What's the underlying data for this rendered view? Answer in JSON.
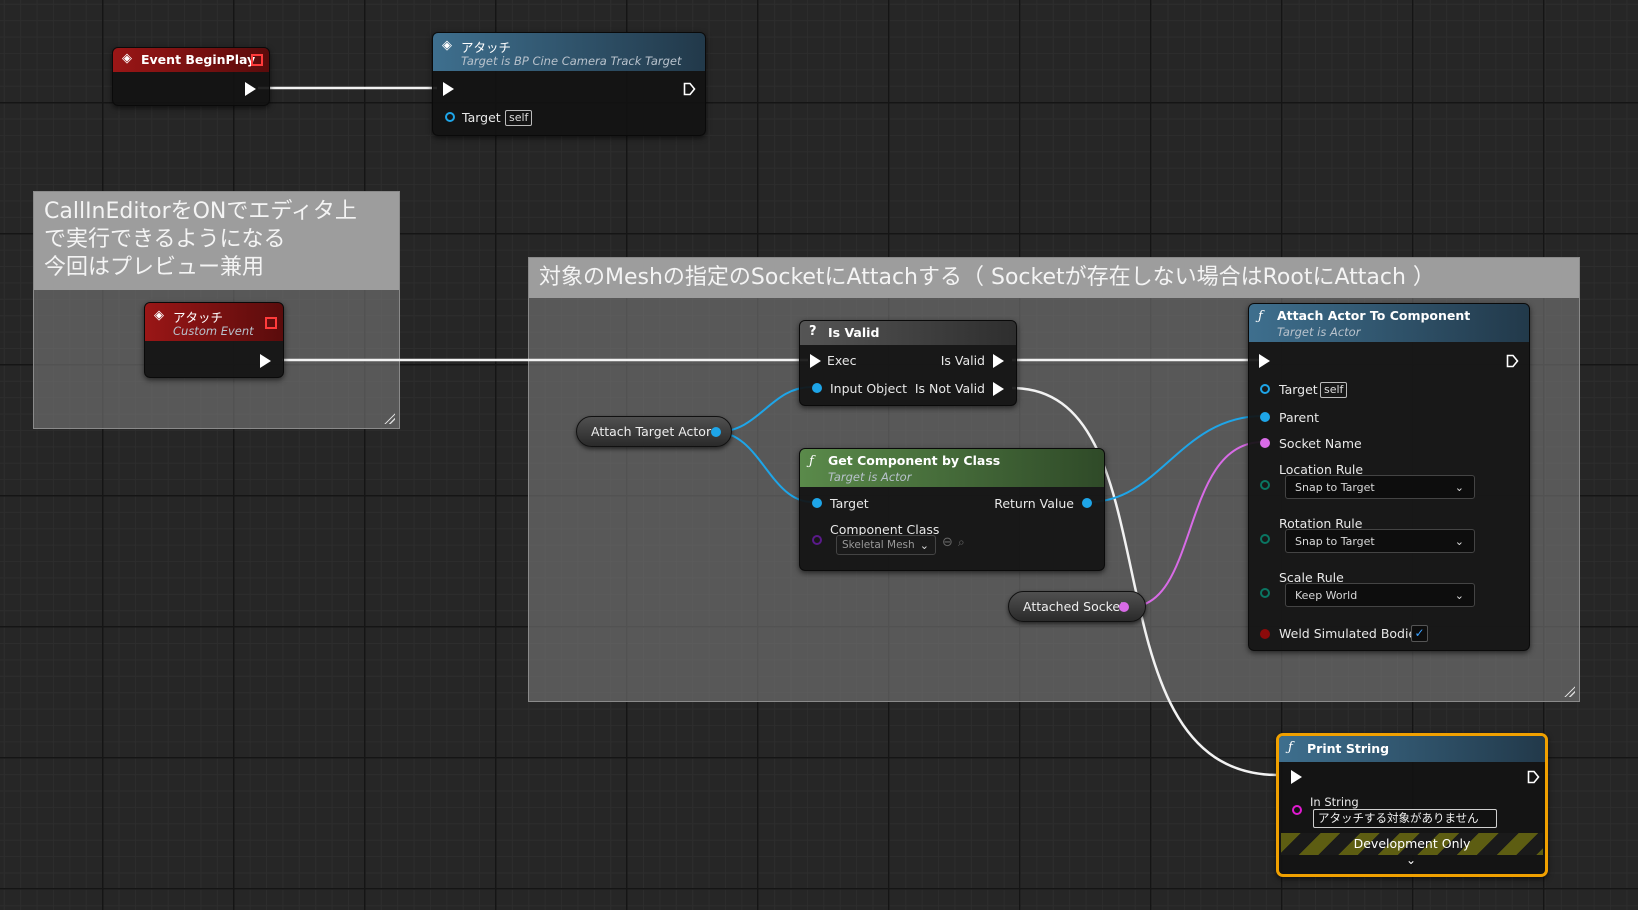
{
  "colors": {
    "exec": "#ffffff",
    "object_pin": "#1ea5e8",
    "name_pin": "#d86be6",
    "string_pin": "#e01ad0",
    "bool_pin": "#8c0a0a",
    "enum_pin": "#0a7562",
    "event_header": "#8a1010",
    "function_header": "#2b5a78",
    "pure_header": "#47713a",
    "selection": "#f0a000"
  },
  "comments": {
    "left": {
      "text": "CallInEditorをONでエディタ上\nで実行できるようになる\n今回はプレビュー兼用"
    },
    "right": {
      "text": "対象のMeshの指定のSocketにAttachする（ Socketが存在しない場合はRootにAttach ）"
    }
  },
  "nodes": {
    "event_begin_play": {
      "title": "Event BeginPlay",
      "icon": "event-diamond-icon"
    },
    "attach_call": {
      "title": "アタッチ",
      "subtitle": "Target is BP Cine Camera Track Target",
      "target_label": "Target",
      "self_label": "self",
      "icon": "function-call-icon"
    },
    "custom_event": {
      "title": "アタッチ",
      "subtitle": "Custom Event",
      "icon": "event-diamond-icon"
    },
    "is_valid": {
      "title": "Is Valid",
      "icon": "question-icon",
      "exec_label": "Exec",
      "input_object_label": "Input Object",
      "is_valid_label": "Is Valid",
      "is_not_valid_label": "Is Not Valid"
    },
    "get_component": {
      "title": "Get Component by Class",
      "subtitle": "Target is Actor",
      "target_label": "Target",
      "component_class_label": "Component Class",
      "component_class_value": "Skeletal Mesh",
      "return_value_label": "Return Value"
    },
    "attach_actor": {
      "title": "Attach Actor To Component",
      "subtitle": "Target is Actor",
      "target_label": "Target",
      "self_label": "self",
      "parent_label": "Parent",
      "socket_name_label": "Socket Name",
      "location_rule_label": "Location Rule",
      "location_rule_value": "Snap to Target",
      "rotation_rule_label": "Rotation Rule",
      "rotation_rule_value": "Snap to Target",
      "scale_rule_label": "Scale Rule",
      "scale_rule_value": "Keep World",
      "weld_label": "Weld Simulated Bodies",
      "weld_checked": true
    },
    "print_string": {
      "title": "Print String",
      "in_string_label": "In String",
      "in_string_value": "アタッチする対象がありません",
      "dev_only_label": "Development Only"
    }
  },
  "variables": {
    "attach_target_actor": "Attach Target Actor",
    "attached_socket": "Attached Socket"
  }
}
